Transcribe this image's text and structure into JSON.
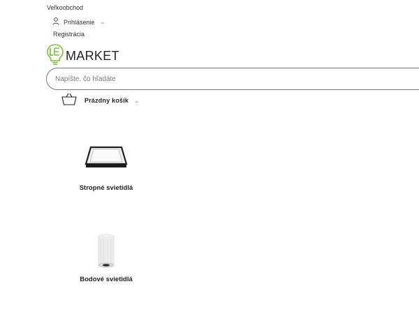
{
  "header": {
    "wholesale_link": "Veľkoobchod",
    "login_label": "Prihlásenie",
    "register_label": "Registrácia"
  },
  "logo": {
    "text": "MARKET",
    "icon": "led-bulb-logo",
    "accent_color": "#7fbf3f"
  },
  "search": {
    "placeholder": "Napíšte, čo hľadáte",
    "value": ""
  },
  "cart": {
    "label": "Prázdny košík",
    "icon": "basket-icon"
  },
  "categories": [
    {
      "label": "Stropné svietidlá",
      "image": "ceiling-light-square"
    },
    {
      "label": "Bodové svietidlá",
      "image": "spot-light-cylinder"
    }
  ]
}
